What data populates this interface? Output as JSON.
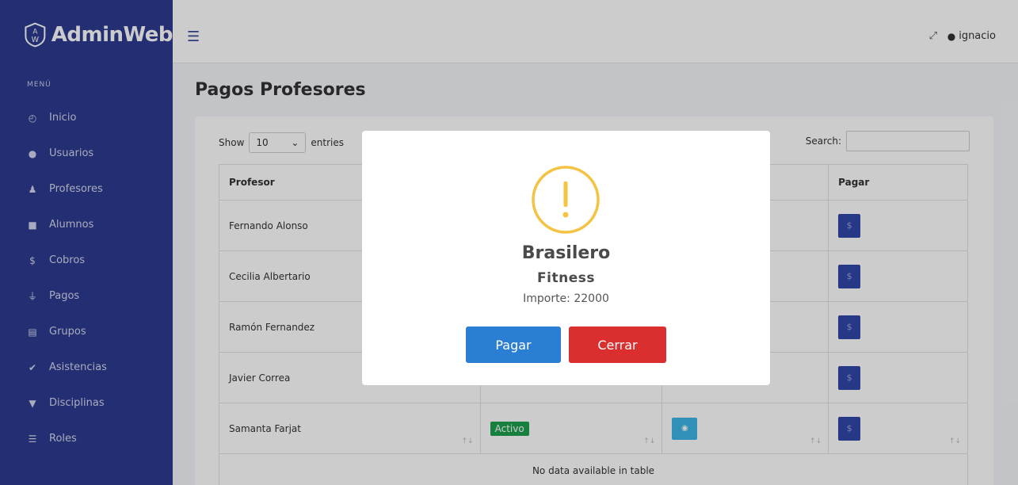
{
  "brand": {
    "name": "AdminWeb",
    "logo_letters": "AW"
  },
  "sidebar": {
    "heading": "MENÚ",
    "items": [
      {
        "label": "Inicio",
        "icon": "gauge-icon"
      },
      {
        "label": "Usuarios",
        "icon": "users-icon"
      },
      {
        "label": "Profesores",
        "icon": "teacher-icon"
      },
      {
        "label": "Alumnos",
        "icon": "student-icon"
      },
      {
        "label": "Cobros",
        "icon": "dollar-icon"
      },
      {
        "label": "Pagos",
        "icon": "hand-money-icon"
      },
      {
        "label": "Grupos",
        "icon": "clipboard-icon"
      },
      {
        "label": "Asistencias",
        "icon": "check-icon"
      },
      {
        "label": "Disciplinas",
        "icon": "trophy-icon"
      },
      {
        "label": "Roles",
        "icon": "list-icon"
      }
    ]
  },
  "topbar": {
    "user": "ignacio"
  },
  "page": {
    "title": "Pagos Profesores"
  },
  "table_controls": {
    "show_label": "Show",
    "entries_value": "10",
    "entries_label": "entries",
    "search_label": "Search:"
  },
  "table": {
    "headers": {
      "profesor": "Profesor",
      "pagar": "Pagar"
    },
    "rows": [
      {
        "profesor": "Fernando Alonso"
      },
      {
        "profesor": "Cecilia Albertario"
      },
      {
        "profesor": "Ramón Fernandez"
      },
      {
        "profesor": "Javier Correa"
      },
      {
        "profesor": "Samanta Farjat",
        "estado": "Activo"
      }
    ],
    "pay_symbol": "$",
    "sort_symbol": "↑↓",
    "empty_message": "No data available in table"
  },
  "modal": {
    "icon_symbol": "!",
    "title": "Brasilero",
    "subtitle": "Fitness",
    "amount_label": "Importe:",
    "amount_value": "22000",
    "confirm_label": "Pagar",
    "cancel_label": "Cerrar"
  },
  "colors": {
    "sidebar": "#2c3b8f",
    "confirm": "#2a7fd4",
    "cancel": "#db2e2e",
    "warning": "#f5c342",
    "badge": "#1fa04f",
    "eye_button": "#3db5e6",
    "pay_button": "#3047a8"
  }
}
